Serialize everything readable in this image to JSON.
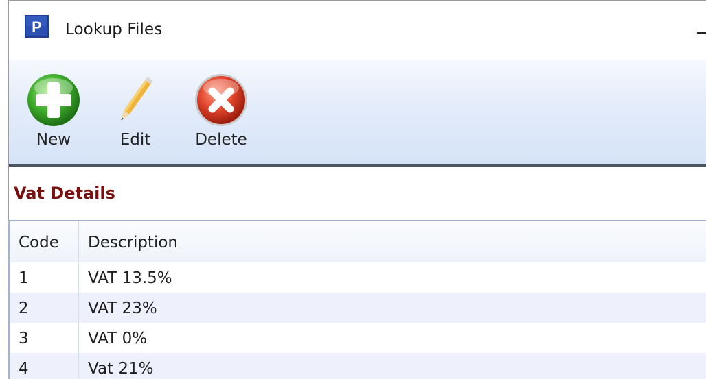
{
  "window": {
    "title": "Lookup Files",
    "app_icon_letter": "P",
    "app_icon_color": "#2747a0"
  },
  "toolbar": {
    "new_label": "New",
    "edit_label": "Edit",
    "delete_label": "Delete"
  },
  "section": {
    "title": "Vat Details",
    "title_color": "#7a0f0f"
  },
  "table": {
    "columns": [
      "Code",
      "Description"
    ],
    "rows": [
      {
        "code": "1",
        "description": "VAT 13.5%"
      },
      {
        "code": "2",
        "description": "VAT 23%"
      },
      {
        "code": "3",
        "description": "VAT 0%"
      },
      {
        "code": "4",
        "description": "Vat 21%"
      }
    ],
    "alt_row_color": "#eef0fb"
  },
  "icons": {
    "new": "plus-circle-green-icon",
    "edit": "pencil-icon",
    "delete": "x-circle-red-icon"
  }
}
